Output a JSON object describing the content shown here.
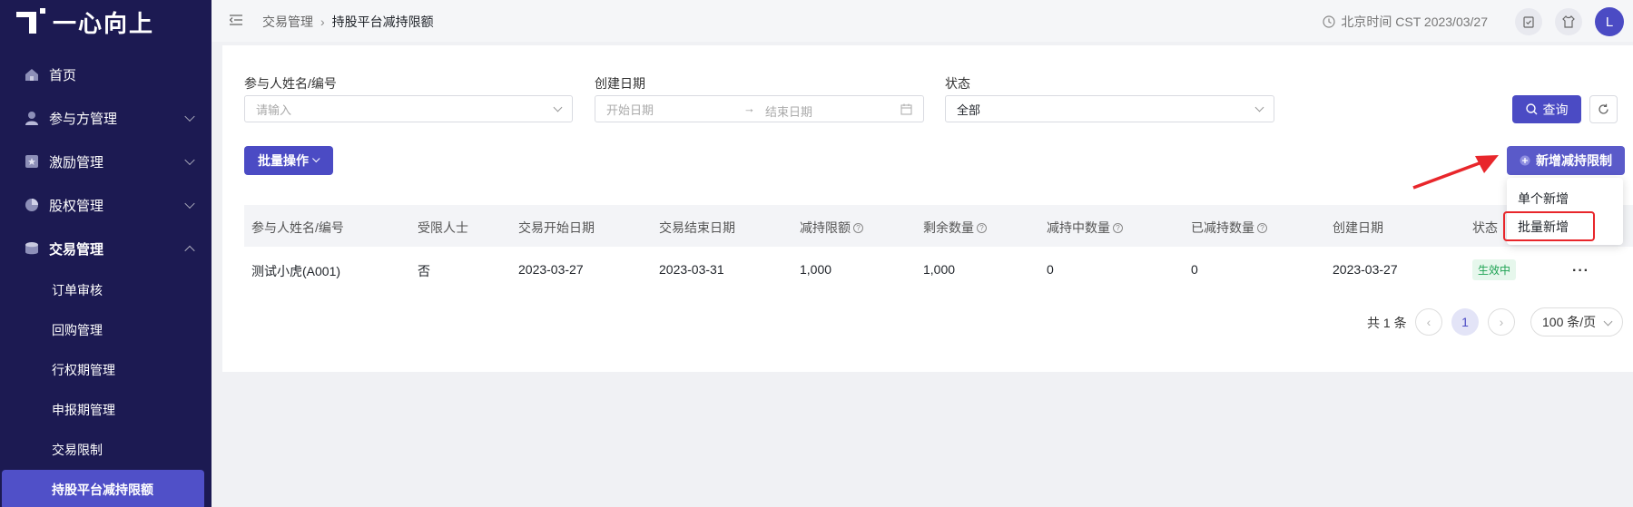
{
  "app": {
    "logo_text": "一心向上"
  },
  "sidebar": {
    "items": [
      {
        "label": "首页",
        "icon": "home-icon"
      },
      {
        "label": "参与方管理",
        "icon": "users-icon"
      },
      {
        "label": "激励管理",
        "icon": "star-icon"
      },
      {
        "label": "股权管理",
        "icon": "pie-icon"
      },
      {
        "label": "交易管理",
        "icon": "trade-icon"
      }
    ],
    "sub_items": [
      "订单审核",
      "回购管理",
      "行权期管理",
      "申报期管理",
      "交易限制",
      "持股平台减持限额"
    ]
  },
  "header": {
    "breadcrumb_parent": "交易管理",
    "breadcrumb_current": "持股平台减持限额",
    "time_text": "北京时间 CST 2023/03/27",
    "avatar_letter": "L"
  },
  "filters": {
    "participant_label": "参与人姓名/编号",
    "participant_placeholder": "请输入",
    "date_label": "创建日期",
    "date_start_placeholder": "开始日期",
    "date_end_placeholder": "结束日期",
    "status_label": "状态",
    "status_value": "全部",
    "query_button": "查询"
  },
  "toolbar": {
    "batch_button": "批量操作",
    "add_button": "新增减持限制",
    "add_menu": [
      "单个新增",
      "批量新增"
    ]
  },
  "table": {
    "columns": [
      "参与人姓名/编号",
      "受限人士",
      "交易开始日期",
      "交易结束日期",
      "减持限额",
      "剩余数量",
      "减持中数量",
      "已减持数量",
      "创建日期",
      "状态"
    ],
    "rows": [
      [
        "测试小虎(A001)",
        "否",
        "2023-03-27",
        "2023-03-31",
        "1,000",
        "1,000",
        "0",
        "0",
        "2023-03-27",
        "生效中"
      ]
    ],
    "more": "···"
  },
  "pagination": {
    "total": "共 1 条",
    "current_page": "1",
    "page_size": "100 条/页"
  },
  "colors": {
    "sidebar_bg": "#1c1a52",
    "primary": "#4b4bc4",
    "highlight": "#e8262b",
    "status_green": "#1fa354"
  }
}
